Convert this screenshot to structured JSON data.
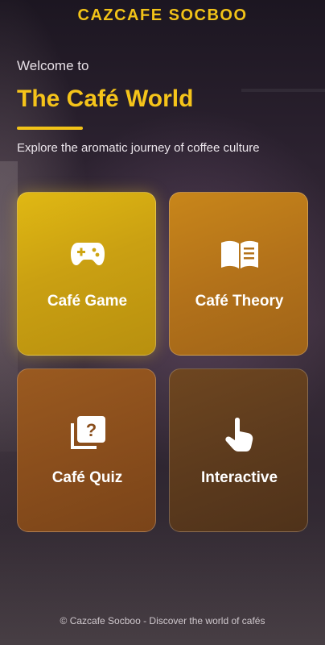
{
  "header": {
    "brand": "CAZCAFE SOCBOO"
  },
  "hero": {
    "welcome": "Welcome to",
    "title": "The Café World",
    "subtitle": "Explore the aromatic journey of coffee culture"
  },
  "cards": [
    {
      "label": "Café Game",
      "icon": "gamepad-icon"
    },
    {
      "label": "Café Theory",
      "icon": "open-book-icon"
    },
    {
      "label": "Café Quiz",
      "icon": "quiz-cards-icon"
    },
    {
      "label": "Interactive",
      "icon": "tap-hand-icon"
    }
  ],
  "footer": {
    "text": "© Cazcafe Socboo - Discover the world of cafés"
  },
  "colors": {
    "accent": "#f2c318",
    "background": "#2c2230"
  }
}
